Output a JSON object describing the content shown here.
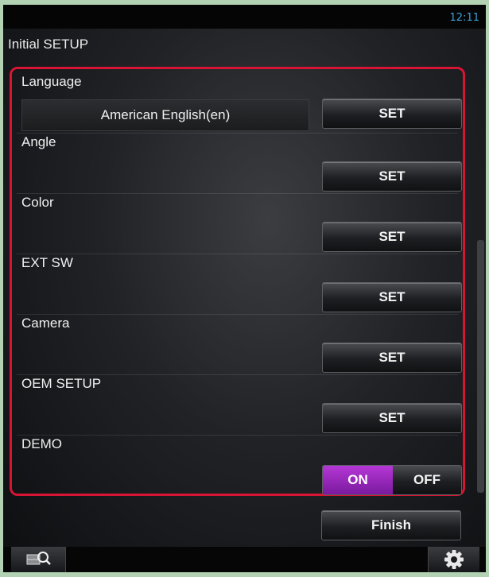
{
  "status": {
    "clock": "12:11"
  },
  "header": {
    "title": "Initial SETUP"
  },
  "settings": [
    {
      "label": "Language",
      "value": "American English(en)",
      "button": "SET"
    },
    {
      "label": "Angle",
      "button": "SET"
    },
    {
      "label": "Color",
      "button": "SET"
    },
    {
      "label": "EXT SW",
      "button": "SET"
    },
    {
      "label": "Camera",
      "button": "SET"
    },
    {
      "label": "OEM SETUP",
      "button": "SET"
    },
    {
      "label": "DEMO",
      "toggle": {
        "on": "ON",
        "off": "OFF",
        "selected": "ON"
      }
    }
  ],
  "footer": {
    "finish_label": "Finish",
    "left_icon": "map-search-icon",
    "right_icon": "gear-icon"
  },
  "colors": {
    "highlight_border": "#d51533",
    "toggle_active": "#9b2ac0",
    "clock": "#3d9fd6"
  }
}
